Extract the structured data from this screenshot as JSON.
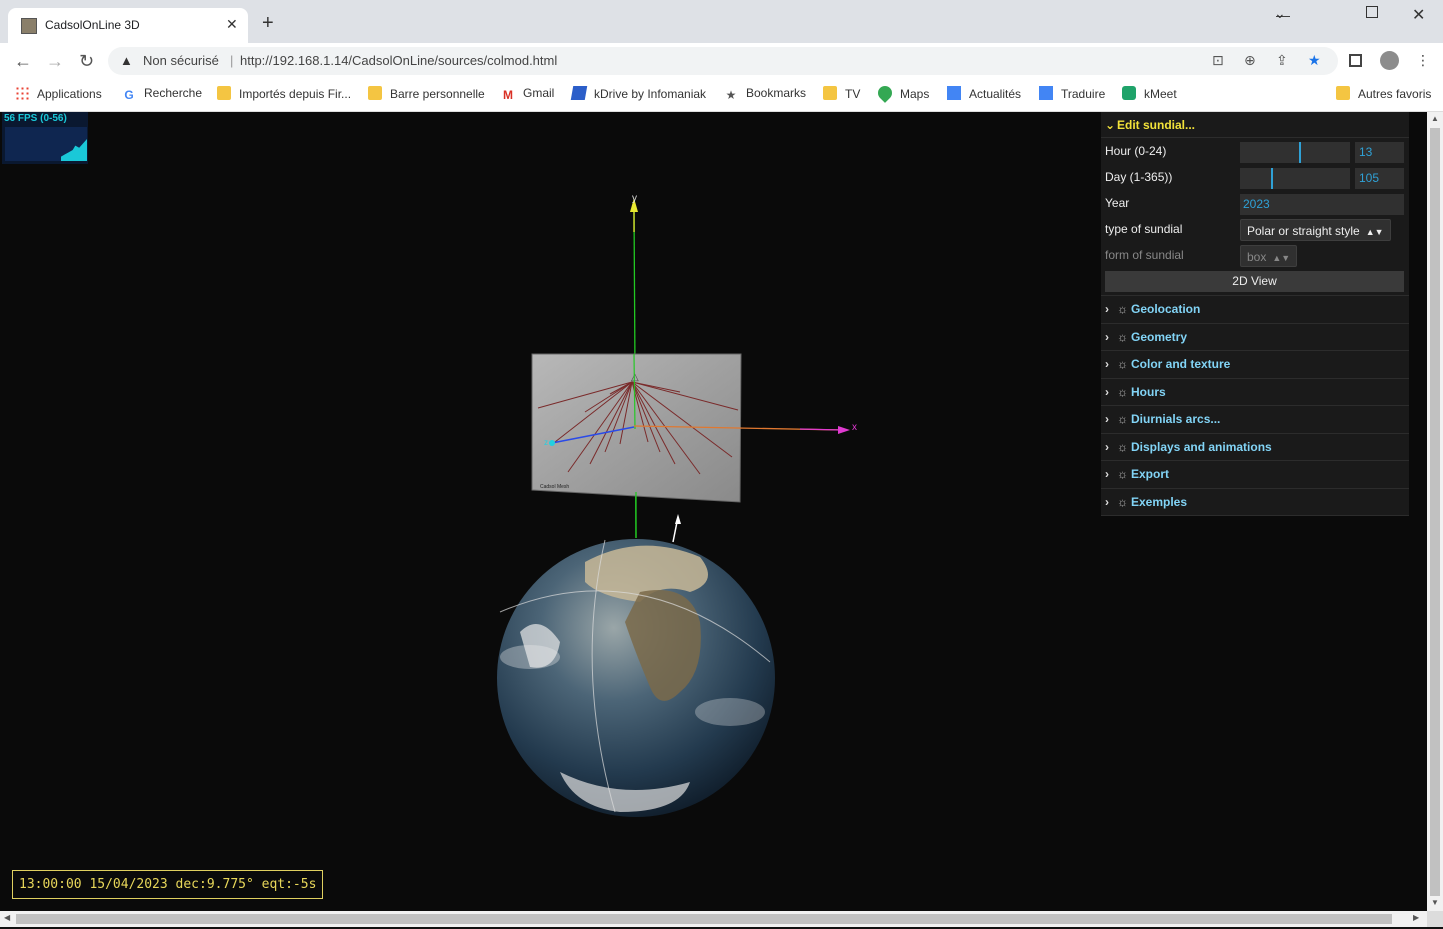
{
  "browser": {
    "tab_title": "CadsolOnLine 3D",
    "close_glyph": "✕",
    "newtab_glyph": "+",
    "security_label": "Non sécurisé",
    "url": "http://192.168.1.14/CadsolOnLine/sources/colmod.html",
    "bookmarks": [
      "Applications",
      "Recherche",
      "Importés depuis Fir...",
      "Barre personnelle",
      "Gmail",
      "kDrive by Infomaniak",
      "Bookmarks",
      "TV",
      "Maps",
      "Actualités",
      "Traduire",
      "kMeet"
    ],
    "other_bookmarks": "Autres favoris",
    "accent_color": "#1a73e8"
  },
  "fps": {
    "label": "56 FPS (0-56)"
  },
  "scene": {
    "axis_x_label": "x",
    "axis_y_label": "y",
    "axis_z_label": "z",
    "dial_signature": "Cadsol Mesh"
  },
  "status": {
    "text": "13:00:00 15/04/2023 dec:9.775° eqt:-5s"
  },
  "gui": {
    "open_folder": "Edit sundial...",
    "hour_label": "Hour  (0-24)",
    "hour_value": "13",
    "hour_fraction": 0.5417,
    "day_label": "Day (1-365))",
    "day_value": "105",
    "day_fraction": 0.2877,
    "year_label": "Year",
    "year_value": "2023",
    "type_label": "type of sundial",
    "type_value": "Polar or straight style",
    "form_label": "form of sundial",
    "form_value": "box",
    "view_button": "2D View",
    "folders": [
      "Geolocation",
      "Geometry",
      "Color and texture",
      "Hours",
      "Diurnials arcs...",
      "Displays and animations",
      "Export",
      "Exemples"
    ],
    "label_color": "#82d4f6",
    "open_color": "#f2e23a",
    "slider_color": "#2fa1d6"
  }
}
